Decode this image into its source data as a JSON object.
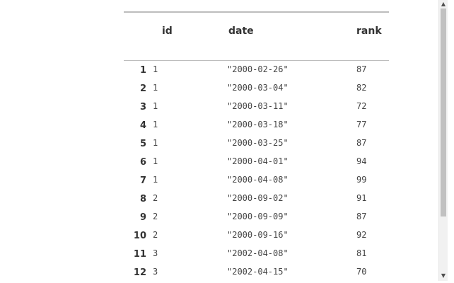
{
  "table": {
    "columns": [
      {
        "key": "rownum",
        "label": ""
      },
      {
        "key": "id",
        "label": "id"
      },
      {
        "key": "date",
        "label": "date"
      },
      {
        "key": "rank",
        "label": "rank"
      }
    ],
    "rows": [
      {
        "rownum": "1",
        "id": "1",
        "date": "\"2000-02-26\"",
        "rank": "87"
      },
      {
        "rownum": "2",
        "id": "1",
        "date": "\"2000-03-04\"",
        "rank": "82"
      },
      {
        "rownum": "3",
        "id": "1",
        "date": "\"2000-03-11\"",
        "rank": "72"
      },
      {
        "rownum": "4",
        "id": "1",
        "date": "\"2000-03-18\"",
        "rank": "77"
      },
      {
        "rownum": "5",
        "id": "1",
        "date": "\"2000-03-25\"",
        "rank": "87"
      },
      {
        "rownum": "6",
        "id": "1",
        "date": "\"2000-04-01\"",
        "rank": "94"
      },
      {
        "rownum": "7",
        "id": "1",
        "date": "\"2000-04-08\"",
        "rank": "99"
      },
      {
        "rownum": "8",
        "id": "2",
        "date": "\"2000-09-02\"",
        "rank": "91"
      },
      {
        "rownum": "9",
        "id": "2",
        "date": "\"2000-09-09\"",
        "rank": "87"
      },
      {
        "rownum": "10",
        "id": "2",
        "date": "\"2000-09-16\"",
        "rank": "92"
      },
      {
        "rownum": "11",
        "id": "3",
        "date": "\"2002-04-08\"",
        "rank": "81"
      },
      {
        "rownum": "12",
        "id": "3",
        "date": "\"2002-04-15\"",
        "rank": "70"
      }
    ]
  },
  "scrollbar": {
    "up_icon": "triangle-up-icon",
    "down_icon": "triangle-down-icon",
    "scroll_position": 0
  },
  "colors": {
    "header_text": "#333333",
    "cell_text": "#444444",
    "rule": "#bdbdbd",
    "scroll_track": "#f1f1f1",
    "scroll_thumb": "#c1c1c1"
  }
}
